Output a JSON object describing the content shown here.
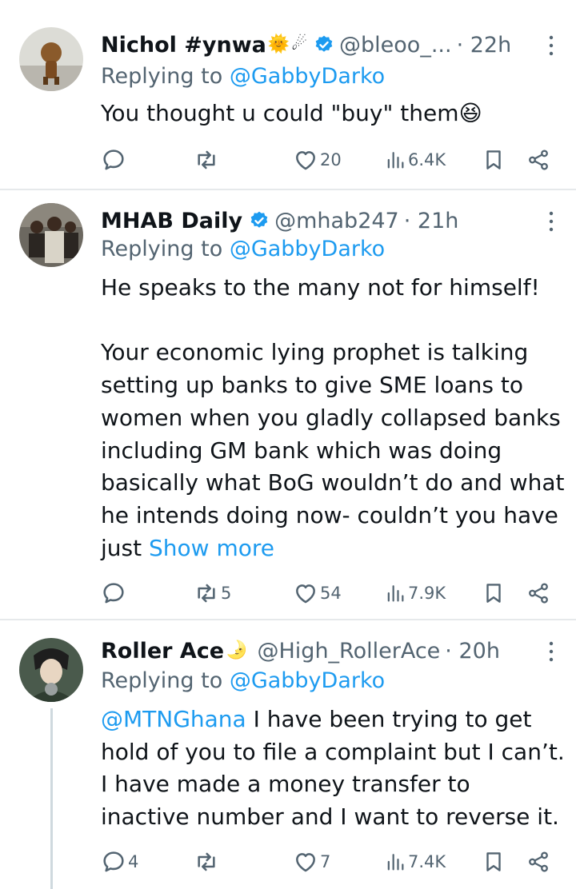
{
  "tweets": [
    {
      "name": "Nichol #ynwa",
      "name_emoji": "🌞",
      "name_emoji2": "☄",
      "handle": "@bleoo_...",
      "time": "· 22h",
      "replying_prefix": "Replying to ",
      "replying_to": "@GabbyDarko",
      "text": "You thought u could \"buy\" them",
      "text_emoji": "😆",
      "counts": {
        "reply": "",
        "retweet": "",
        "like": "20",
        "views": "6.4K"
      }
    },
    {
      "name": "MHAB Daily",
      "handle": "@mhab247",
      "time": "· 21h",
      "replying_prefix": "Replying to ",
      "replying_to": "@GabbyDarko",
      "text": "He speaks to the many not for himself!\n\nYour economic lying prophet is talking setting up banks to give SME loans to women when you gladly collapsed banks including GM bank which was doing basically what BoG wouldn’t do and what he intends doing now- couldn’t you have just ",
      "show_more": "Show more",
      "counts": {
        "reply": "",
        "retweet": "5",
        "like": "54",
        "views": "7.9K"
      }
    },
    {
      "name": "Roller Ace",
      "name_emoji": "🌛",
      "handle": "@High_RollerAce",
      "time": "· 20h",
      "replying_prefix": "Replying to ",
      "replying_to": "@GabbyDarko",
      "mention": "@MTNGhana",
      "text": " I have been trying to get hold of you to file a complaint but I can’t. I have made a money transfer to inactive number and I want to reverse it.",
      "counts": {
        "reply": "4",
        "retweet": "",
        "like": "7",
        "views": "7.4K"
      }
    }
  ],
  "colors": {
    "verified": "#1d9bf0",
    "link": "#1d9bf0",
    "secondary_text": "#536471",
    "divider": "#e6e9eb"
  },
  "icons": [
    "reply-icon",
    "retweet-icon",
    "like-icon",
    "views-icon",
    "bookmark-icon",
    "share-icon",
    "more-icon",
    "verified-badge-icon"
  ]
}
